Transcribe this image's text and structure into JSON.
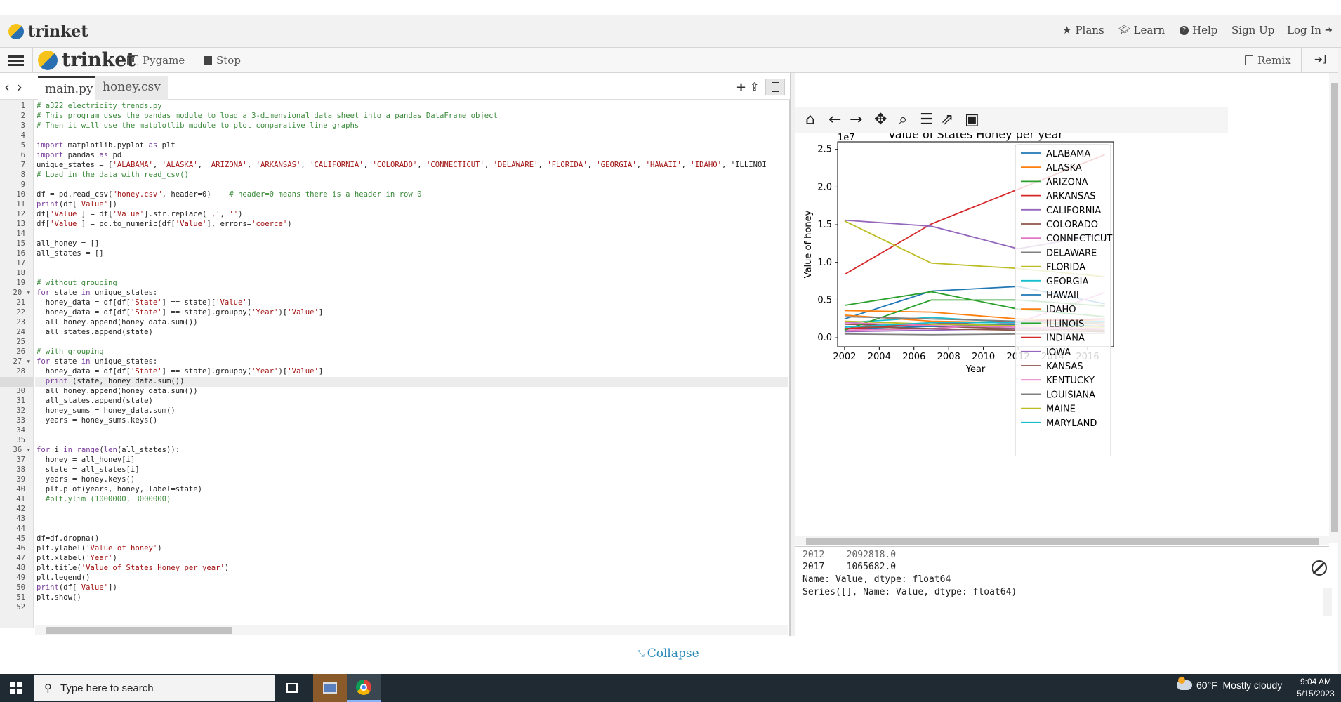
{
  "site_header": {
    "brand": "trinket",
    "nav": [
      {
        "icon": "star-icon",
        "label": "Plans"
      },
      {
        "icon": "graduation-cap-icon",
        "label": "Learn"
      },
      {
        "icon": "question-circle-icon",
        "label": "Help"
      },
      {
        "icon": "",
        "label": "Sign Up"
      },
      {
        "icon": "sign-in-icon",
        "label": "Log In"
      }
    ]
  },
  "toolbar": {
    "brand": "trinket",
    "pygame_label": "Pygame",
    "stop_label": "Stop",
    "remix_label": "Remix"
  },
  "editor": {
    "tabs": [
      "main.py",
      "honey.csv"
    ],
    "current_line": 29,
    "lines": [
      "# a322_electricity_trends.py",
      "# This program uses the pandas module to load a 3-dimensional data sheet into a pandas DataFrame object",
      "# Then it will use the matplotlib module to plot comparative line graphs",
      "",
      "import matplotlib.pyplot as plt",
      "import pandas as pd",
      "unique_states = ['ALABAMA', 'ALASKA', 'ARIZONA', 'ARKANSAS', 'CALIFORNIA', 'COLORADO', 'CONNECTICUT', 'DELAWARE', 'FLORIDA', 'GEORGIA', 'HAWAII', 'IDAHO', 'ILLINOI",
      "# Load in the data with read_csv()",
      "",
      "df = pd.read_csv(\"honey.csv\", header=0)    # header=0 means there is a header in row 0",
      "print(df['Value'])",
      "df['Value'] = df['Value'].str.replace(',', '')",
      "df['Value'] = pd.to_numeric(df['Value'], errors='coerce')",
      "",
      "all_honey = []",
      "all_states = []",
      "",
      "",
      "# without grouping",
      "for state in unique_states:",
      "  honey_data = df[df['State'] == state]['Value']",
      "  honey_data = df[df['State'] == state].groupby('Year')['Value']",
      "  all_honey.append(honey_data.sum())",
      "  all_states.append(state)",
      "",
      "# with grouping",
      "for state in unique_states:",
      "  honey_data = df[df['State'] == state].groupby('Year')['Value']",
      "  print (state, honey_data.sum())",
      "  all_honey.append(honey_data.sum())",
      "  all_states.append(state)",
      "  honey_sums = honey_data.sum()",
      "  years = honey_sums.keys()",
      "",
      "",
      "for i in range(len(all_states)):",
      "  honey = all_honey[i]",
      "  state = all_states[i]",
      "  years = honey.keys()",
      "  plt.plot(years, honey, label=state)",
      "  #plt.ylim (1000000, 3000000)",
      "",
      "",
      "",
      "df=df.dropna()",
      "plt.ylabel('Value of honey')",
      "plt.xlabel('Year')",
      "plt.title('Value of States Honey per year')",
      "plt.legend()",
      "print(df['Value'])",
      "plt.show()",
      ""
    ],
    "fold_lines": [
      20,
      27,
      36
    ]
  },
  "chart_data": {
    "type": "line",
    "title": "Value of States Honey per year",
    "xlabel": "Year",
    "ylabel": "Value of honey",
    "y_offset_label": "1e7",
    "xlim": [
      2001.6,
      2017.5
    ],
    "ylim": [
      -0.12,
      2.6
    ],
    "x_ticks": [
      2002,
      2004,
      2006,
      2008,
      2010,
      2012,
      2014,
      2016
    ],
    "y_ticks": [
      0.0,
      0.5,
      1.0,
      1.5,
      2.0,
      2.5
    ],
    "x_tick_labels": [
      "2002",
      "2004",
      "2006",
      "2008",
      "2010",
      "2012",
      "2014",
      "2016"
    ],
    "y_tick_labels": [
      "0.0",
      "0.5",
      "1.0",
      "1.5",
      "2.0",
      "2.5"
    ],
    "legend_position": "upper right",
    "x": [
      2002,
      2007,
      2012,
      2017
    ],
    "series": [
      {
        "name": "ALABAMA",
        "color": "#1f77b4",
        "values": [
          0.25,
          0.62,
          0.68,
          0.45
        ]
      },
      {
        "name": "ALASKA",
        "color": "#ff7f0e",
        "values": [
          0.36,
          0.34,
          0.25,
          0.22
        ]
      },
      {
        "name": "ARIZONA",
        "color": "#2ca02c",
        "values": [
          0.43,
          0.61,
          0.38,
          0.28
        ]
      },
      {
        "name": "ARKANSAS",
        "color": "#d62728",
        "values": [
          0.84,
          1.51,
          1.97,
          2.43
        ]
      },
      {
        "name": "CALIFORNIA",
        "color": "#9467bd",
        "values": [
          1.56,
          1.48,
          1.18,
          1.38
        ]
      },
      {
        "name": "COLORADO",
        "color": "#8c564b",
        "values": [
          0.18,
          0.15,
          0.12,
          0.1
        ]
      },
      {
        "name": "CONNECTICUT",
        "color": "#e377c2",
        "values": [
          0.1,
          0.12,
          0.2,
          0.6
        ]
      },
      {
        "name": "DELAWARE",
        "color": "#7f7f7f",
        "values": [
          0.05,
          0.04,
          0.05,
          0.06
        ]
      },
      {
        "name": "FLORIDA",
        "color": "#bcbd22",
        "values": [
          1.55,
          0.99,
          0.92,
          0.81
        ]
      },
      {
        "name": "GEORGIA",
        "color": "#17becf",
        "values": [
          0.2,
          0.27,
          0.2,
          0.15
        ]
      },
      {
        "name": "HAWAII",
        "color": "#1f77b4",
        "values": [
          0.12,
          0.15,
          0.18,
          0.2
        ]
      },
      {
        "name": "IDAHO",
        "color": "#ff7f0e",
        "values": [
          0.3,
          0.22,
          0.2,
          0.18
        ]
      },
      {
        "name": "ILLINOIS",
        "color": "#2ca02c",
        "values": [
          0.1,
          0.5,
          0.5,
          0.42
        ]
      },
      {
        "name": "INDIANA",
        "color": "#d62728",
        "values": [
          0.12,
          0.18,
          0.22,
          0.25
        ]
      },
      {
        "name": "IOWA",
        "color": "#9467bd",
        "values": [
          0.08,
          0.1,
          0.12,
          0.16
        ]
      },
      {
        "name": "KANSAS",
        "color": "#8c564b",
        "values": [
          0.15,
          0.12,
          0.1,
          0.08
        ]
      },
      {
        "name": "KENTUCKY",
        "color": "#e377c2",
        "values": [
          0.2,
          0.16,
          0.14,
          0.12
        ]
      },
      {
        "name": "LOUISIANA",
        "color": "#7f7f7f",
        "values": [
          0.28,
          0.25,
          0.22,
          0.2
        ]
      },
      {
        "name": "MAINE",
        "color": "#bcbd22",
        "values": [
          0.22,
          0.18,
          0.16,
          0.14
        ]
      },
      {
        "name": "MARYLAND",
        "color": "#17becf",
        "values": [
          0.14,
          0.2,
          0.2,
          0.22
        ]
      }
    ]
  },
  "console": {
    "lines": [
      "2012    2092818.0",
      "2017    1065682.0",
      "Name: Value, dtype: float64",
      "Series([], Name: Value, dtype: float64)"
    ]
  },
  "collapse_label": "Collapse",
  "taskbar": {
    "search_placeholder": "Type here to search",
    "weather": "60°F  Mostly cloudy",
    "time": "9:04 AM",
    "date": "5/15/2023"
  }
}
